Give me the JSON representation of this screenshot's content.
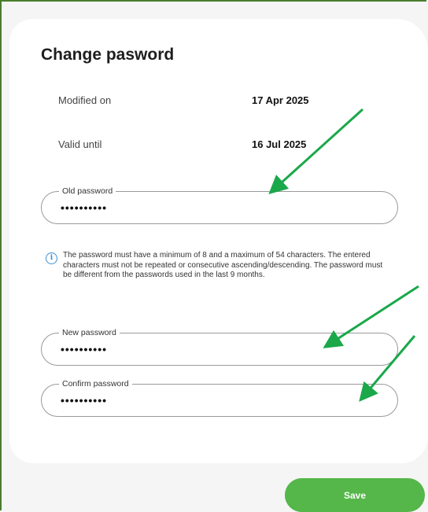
{
  "title": "Change pasword",
  "info": {
    "modified_label": "Modified on",
    "modified_value": "17 Apr 2025",
    "valid_label": "Valid until",
    "valid_value": "16 Jul 2025"
  },
  "fields": {
    "old": {
      "label": "Old password",
      "value": "••••••••••"
    },
    "new": {
      "label": "New password",
      "value": "••••••••••"
    },
    "confirm": {
      "label": "Confirm password",
      "value": "••••••••••"
    }
  },
  "hint": {
    "icon": "info-icon",
    "text": "The password must have a minimum of 8 and a maximum of 54 characters. The entered characters must not be repeated or consecutive ascending/descending. The password must be different from the passwords used in the last 9 months."
  },
  "save_label": "Save",
  "colors": {
    "frame_border": "#4a7d2e",
    "save_button": "#55b64a",
    "annotation_arrow": "#1aa84a",
    "info_icon": "#3a8fd4"
  }
}
